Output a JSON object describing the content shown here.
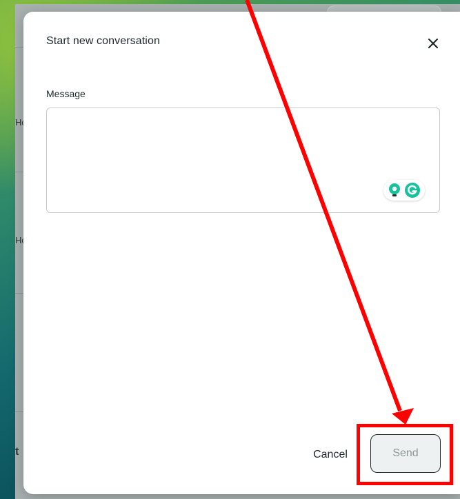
{
  "background": {
    "fragments": [
      "Hc",
      "Hc",
      "t"
    ]
  },
  "modal": {
    "title": "Start new conversation",
    "close_icon": "close-icon",
    "message_label": "Message",
    "message_value": "",
    "message_placeholder": "",
    "grammarly_icons": [
      "lightbulb-icon",
      "grammarly-g-icon"
    ],
    "cancel_label": "Cancel",
    "send_label": "Send"
  },
  "colors": {
    "annotation": "#ff0000",
    "grammarly_green": "#15c39a",
    "text_dark": "#1d2929",
    "send_disabled_text": "#8c9595"
  }
}
